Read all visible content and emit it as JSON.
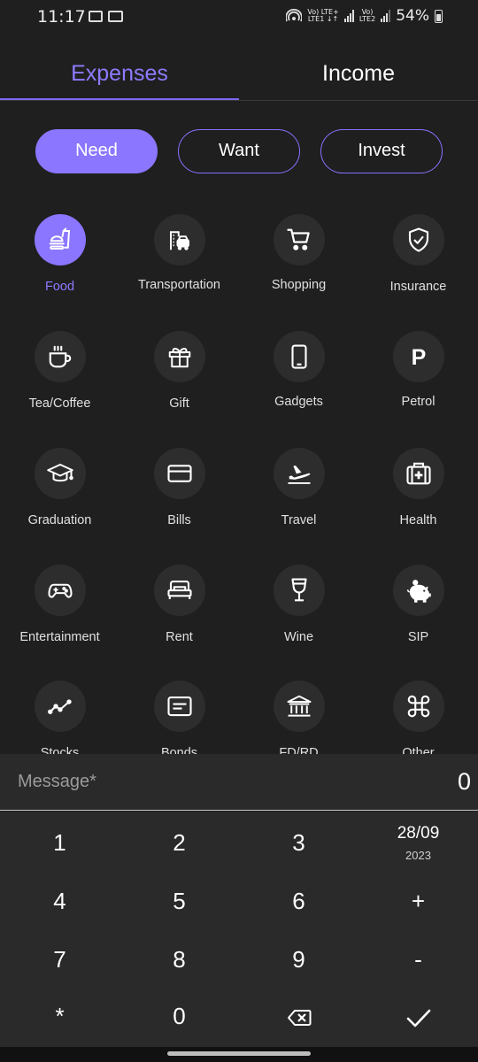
{
  "status_bar": {
    "time": "11:17",
    "net1": "Vo) LTE+",
    "net1_sub": "LTE1 ↓↑",
    "net2": "Vo)",
    "net2_sub": "LTE2",
    "battery": "54%"
  },
  "tabs": [
    {
      "label": "Expenses",
      "active": true
    },
    {
      "label": "Income",
      "active": false
    }
  ],
  "types": [
    {
      "label": "Need",
      "active": true
    },
    {
      "label": "Want",
      "active": false
    },
    {
      "label": "Invest",
      "active": false
    }
  ],
  "categories": [
    {
      "label": "Food",
      "icon": "food-icon",
      "active": true
    },
    {
      "label": "Transportation",
      "icon": "transportation-icon"
    },
    {
      "label": "Shopping",
      "icon": "cart-icon"
    },
    {
      "label": "Insurance",
      "icon": "shield-check-icon"
    },
    {
      "label": "Tea/Coffee",
      "icon": "coffee-mug-icon"
    },
    {
      "label": "Gift",
      "icon": "gift-icon"
    },
    {
      "label": "Gadgets",
      "icon": "phone-icon"
    },
    {
      "label": "Petrol",
      "icon": "parking-p-icon"
    },
    {
      "label": "Graduation",
      "icon": "graduation-cap-icon"
    },
    {
      "label": "Bills",
      "icon": "card-icon"
    },
    {
      "label": "Travel",
      "icon": "plane-icon"
    },
    {
      "label": "Health",
      "icon": "first-aid-kit-icon"
    },
    {
      "label": "Entertainment",
      "icon": "gamepad-icon"
    },
    {
      "label": "Rent",
      "icon": "bed-icon"
    },
    {
      "label": "Wine",
      "icon": "wine-glass-icon"
    },
    {
      "label": "SIP",
      "icon": "piggy-bank-icon"
    },
    {
      "label": "Stocks",
      "icon": "trend-line-icon"
    },
    {
      "label": "Bonds",
      "icon": "certificate-icon"
    },
    {
      "label": "FD/RD",
      "icon": "bank-icon"
    },
    {
      "label": "Other",
      "icon": "command-icon"
    }
  ],
  "message": {
    "placeholder": "Message*",
    "amount": "0"
  },
  "keypad": {
    "k1": "1",
    "k2": "2",
    "k3": "3",
    "date": "28/09",
    "year": "2023",
    "k4": "4",
    "k5": "5",
    "k6": "6",
    "plus": "+",
    "k7": "7",
    "k8": "8",
    "k9": "9",
    "minus": "-",
    "star": "*",
    "k0": "0"
  },
  "colors": {
    "accent": "#8a76ff",
    "background": "#1f1f1f",
    "keypad": "#2a2a2a"
  }
}
